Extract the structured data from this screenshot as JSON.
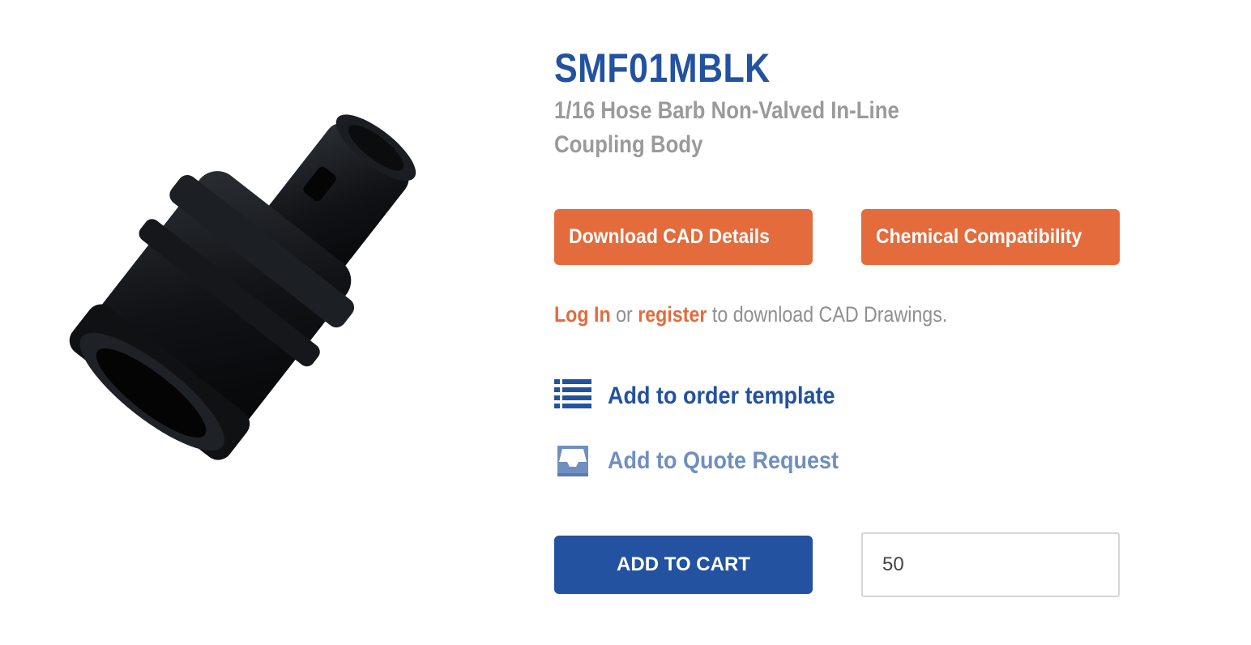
{
  "product": {
    "sku": "SMF01MBLK",
    "description": "1/16 Hose Barb Non-Valved In-Line Coupling Body",
    "image_alt": "black coupling body"
  },
  "buttons": {
    "download_cad": "Download CAD Details",
    "chemical_compat": "Chemical Compatibility",
    "add_to_cart": "ADD TO CART"
  },
  "login_prompt": {
    "login": "Log In",
    "or": "or",
    "register": "register",
    "suffix": "to download CAD Drawings."
  },
  "actions": {
    "order_template": "Add to order template",
    "quote_request": "Add to Quote Request"
  },
  "quantity": {
    "value": "50"
  },
  "colors": {
    "brand_blue": "#2252a0",
    "accent_orange": "#e36b3c",
    "muted_blue": "#6f8fc0",
    "gray_text": "#9a9a9a"
  },
  "icons": {
    "order_template": "list-icon",
    "quote_request": "inbox-tray-icon"
  }
}
